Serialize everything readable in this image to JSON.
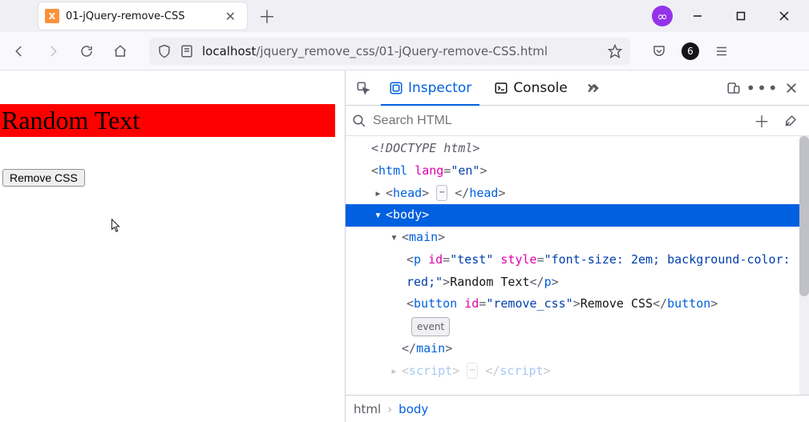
{
  "titlebar": {
    "tab_title": "01-jQuery-remove-CSS",
    "favicon_letter": "𝗫"
  },
  "toolbar": {
    "url_host": "localhost",
    "url_path": "/jquery_remove_css/01-jQuery-remove-CSS.html",
    "notif_count": "6"
  },
  "page": {
    "random_text": "Random Text",
    "remove_btn": "Remove CSS"
  },
  "devtools": {
    "tabs": {
      "inspector": "Inspector",
      "console": "Console"
    },
    "search_placeholder": "Search HTML",
    "dom": {
      "doctype": "<!DOCTYPE html>",
      "html_open": {
        "pre": "<",
        "tag": "html",
        "sp": " ",
        "attr": "lang",
        "eq": "=",
        "val": "\"en\"",
        "post": ">"
      },
      "head": {
        "open_pre": "<",
        "open_tag": "head",
        "open_post": ">",
        "close_pre": "</",
        "close_tag": "head",
        "close_post": ">"
      },
      "body": {
        "open_pre": "<",
        "open_tag": "body",
        "open_post": ">"
      },
      "main": {
        "open_pre": "<",
        "open_tag": "main",
        "open_post": ">",
        "close_pre": "</",
        "close_tag": "main",
        "close_post": ">"
      },
      "p": {
        "open_pre": "<",
        "open_tag": "p",
        "sp1": " ",
        "attr_id": "id",
        "eq1": "=",
        "val_id": "\"test\"",
        "sp2": " ",
        "attr_style": "style",
        "eq2": "=",
        "val_style": "\"font-size: 2em; background-color: red;\"",
        "open_post": ">",
        "text": "Random Text",
        "close_pre": "</",
        "close_tag": "p",
        "close_post": ">"
      },
      "button": {
        "open_pre": "<",
        "open_tag": "button",
        "sp": " ",
        "attr_id": "id",
        "eq": "=",
        "val_id": "\"remove_css\"",
        "open_post": ">",
        "text": "Remove CSS",
        "close_pre": "</",
        "close_tag": "button",
        "close_post": ">",
        "event_badge": "event"
      },
      "script_row": {
        "open_pre": "<",
        "open_tag": "script",
        "open_post": ">",
        "close_pre": "</",
        "close_tag": "script",
        "close_post": ">"
      }
    },
    "crumbs": {
      "root": "html",
      "sep": "›",
      "cur": "body"
    }
  }
}
